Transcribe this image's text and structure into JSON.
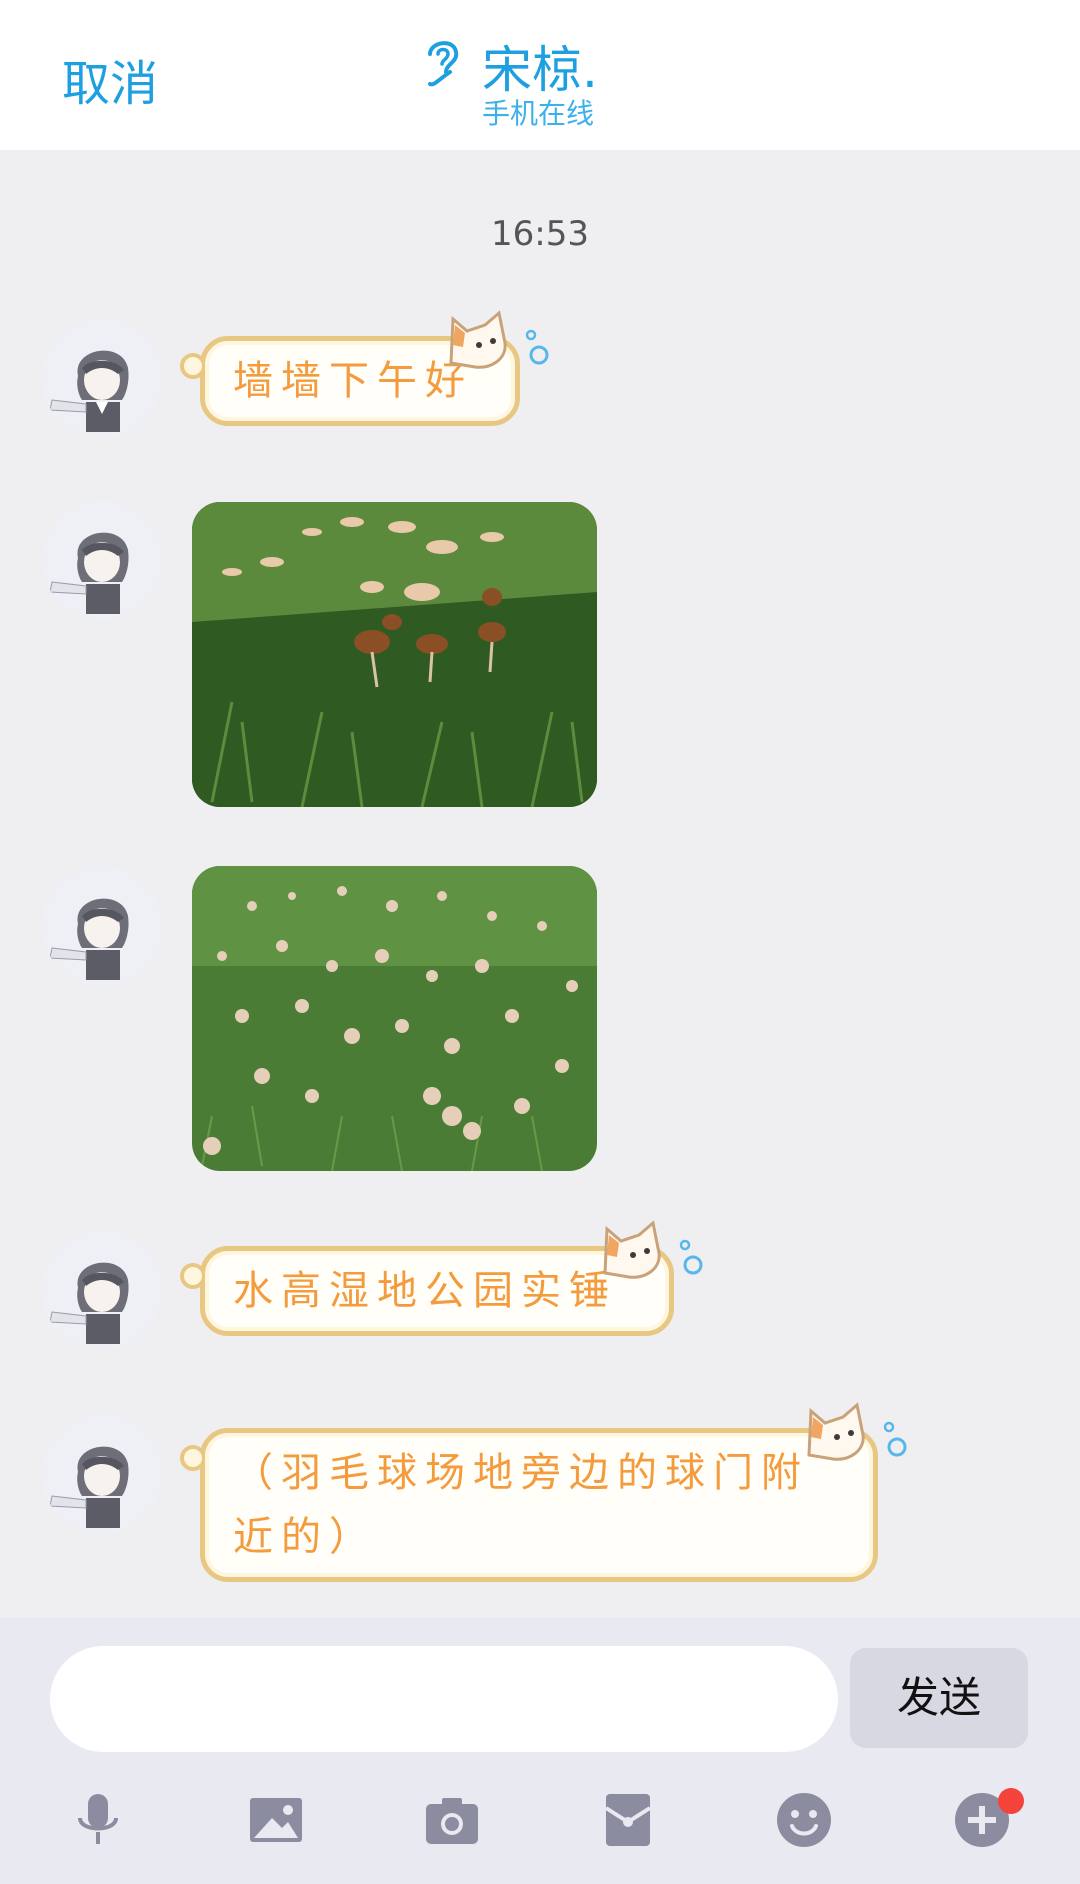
{
  "header": {
    "cancel_label": "取消",
    "contact_name": "宋椋.",
    "contact_status": "手机在线"
  },
  "chat": {
    "timestamp": "16:53",
    "messages": [
      {
        "type": "text",
        "text": "墙墙下午好"
      },
      {
        "type": "image",
        "image": "mushrooms-in-grass-closeup"
      },
      {
        "type": "image",
        "image": "mushrooms-in-grass-field"
      },
      {
        "type": "text",
        "text": "水高湿地公园实锤"
      },
      {
        "type": "text",
        "text": "（羽毛球场地旁边的球门附近的）"
      }
    ]
  },
  "input": {
    "value": "",
    "placeholder": "",
    "send_label": "发送"
  },
  "toolbar": {
    "icons": [
      "microphone-icon",
      "image-icon",
      "camera-icon",
      "red-packet-icon",
      "emoji-icon",
      "plus-icon"
    ]
  },
  "colors": {
    "accent": "#1ea0e0",
    "bubble_text": "#f39b3d",
    "bubble_border": "#e8c783",
    "badge": "#f4433a",
    "icon_gray": "#8c8ca0"
  }
}
